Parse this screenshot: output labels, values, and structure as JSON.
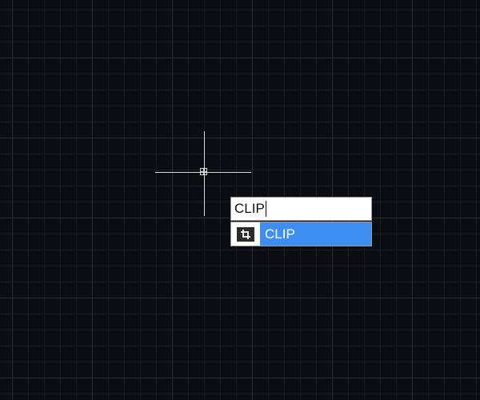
{
  "command_line": {
    "input_value": "CLIP"
  },
  "autocomplete": {
    "items": [
      {
        "label": "CLIP",
        "icon": "clip-icon",
        "selected": true
      }
    ]
  },
  "colors": {
    "canvas_background": "#0c0d12",
    "grid_major": "#2a2c36",
    "grid_minor": "#1b1c24",
    "crosshair": "#d8d8d8",
    "selection_highlight": "#3d8ef0"
  }
}
